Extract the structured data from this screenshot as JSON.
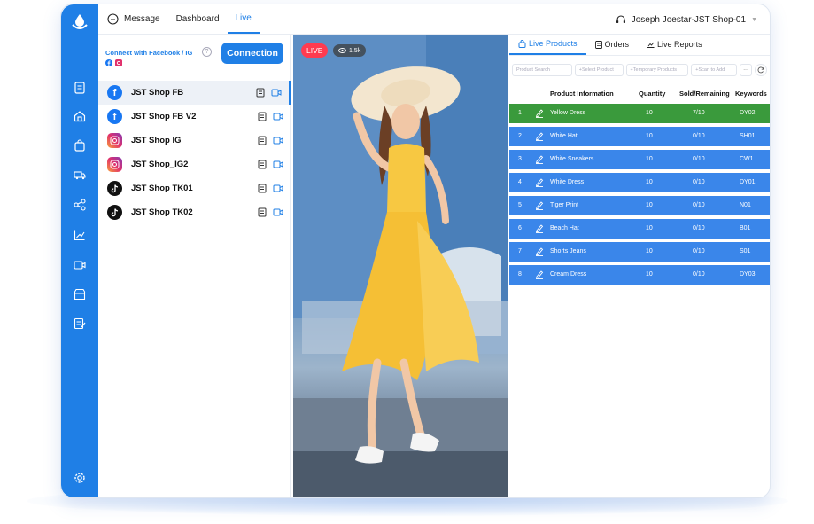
{
  "nav": {
    "message": "Message",
    "dashboard": "Dashboard",
    "live": "Live"
  },
  "user": {
    "name": "Joseph Joestar-JST Shop-01"
  },
  "left": {
    "connect_label": "Connect with Facebook / IG",
    "help": "?",
    "connection_button": "Connection",
    "shops": [
      {
        "name": "JST Shop FB",
        "platform": "facebook"
      },
      {
        "name": "JST Shop FB V2",
        "platform": "facebook"
      },
      {
        "name": "JST Shop IG",
        "platform": "instagram"
      },
      {
        "name": "JST Shop_IG2",
        "platform": "instagram"
      },
      {
        "name": "JST Shop TK01",
        "platform": "tiktok"
      },
      {
        "name": "JST Shop TK02",
        "platform": "tiktok"
      }
    ]
  },
  "video": {
    "live_badge": "LIVE",
    "views": "1.5k"
  },
  "tabs": {
    "live_products": "Live Products",
    "orders": "Orders",
    "live_reports": "Live Reports"
  },
  "toolbar": {
    "search_placeholder": "Product Search",
    "select_product": "+Select Product",
    "temporary_products": "+Temporary Products",
    "scan_to_add": "+Scan to Add",
    "more": "···"
  },
  "table": {
    "headers": {
      "info": "Product Information",
      "quantity": "Quantity",
      "sold": "Sold/Remaining",
      "keywords": "Keywords"
    },
    "rows": [
      {
        "no": "1",
        "name": "Yellow Dress",
        "qty": "10",
        "sold": "7/10",
        "kw": "DY02"
      },
      {
        "no": "2",
        "name": "White Hat",
        "qty": "10",
        "sold": "0/10",
        "kw": "SH01"
      },
      {
        "no": "3",
        "name": "White Sneakers",
        "qty": "10",
        "sold": "0/10",
        "kw": "CW1"
      },
      {
        "no": "4",
        "name": "White Dress",
        "qty": "10",
        "sold": "0/10",
        "kw": "DY01"
      },
      {
        "no": "5",
        "name": "Tiger Print",
        "qty": "10",
        "sold": "0/10",
        "kw": "N01"
      },
      {
        "no": "6",
        "name": "Beach Hat",
        "qty": "10",
        "sold": "0/10",
        "kw": "B01"
      },
      {
        "no": "7",
        "name": "Shorts Jeans",
        "qty": "10",
        "sold": "0/10",
        "kw": "S01"
      },
      {
        "no": "8",
        "name": "Cream Dress",
        "qty": "10",
        "sold": "0/10",
        "kw": "DY03"
      }
    ]
  },
  "colors": {
    "brand": "#1f7fe6",
    "row_blue": "#3a86ea",
    "row_green": "#3a9a3c",
    "live_red": "#ff3b50"
  },
  "icons": [
    "logo-icon",
    "document-icon",
    "home-icon",
    "bag-icon",
    "truck-icon",
    "share-icon",
    "chart-icon",
    "video-icon",
    "store-icon",
    "edit-note-icon",
    "settings-icon",
    "chat-icon",
    "headset-icon",
    "facebook-icon",
    "instagram-icon",
    "tiktok-icon",
    "file-icon",
    "camera-icon",
    "eye-icon",
    "edit-icon",
    "refresh-icon"
  ]
}
